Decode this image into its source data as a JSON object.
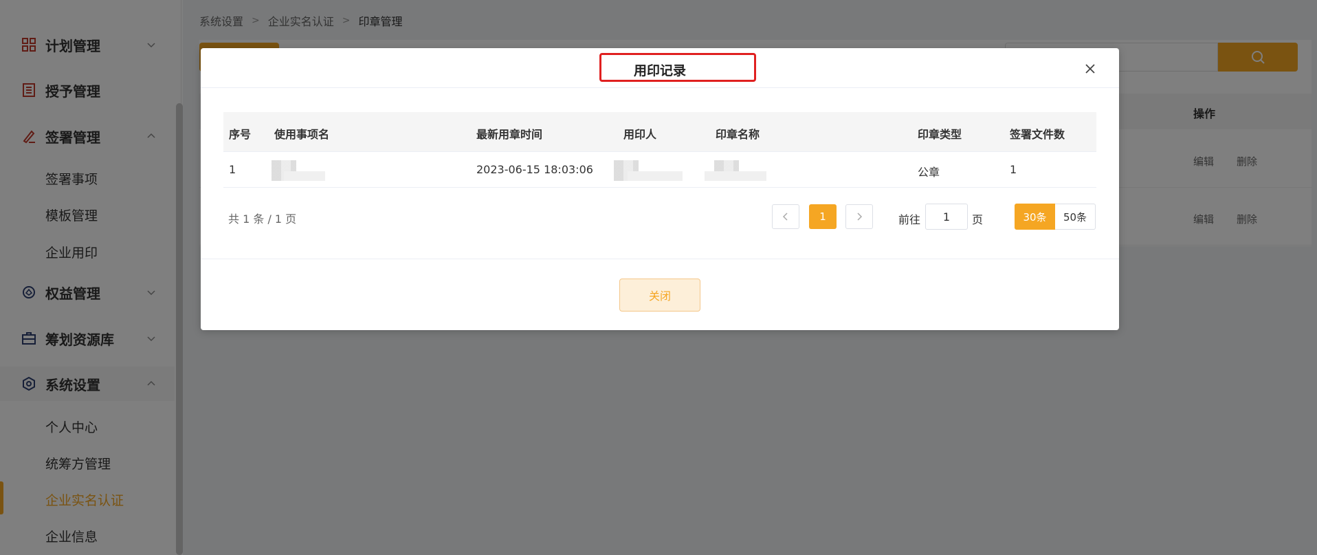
{
  "sidebar": {
    "groups": [
      {
        "label": "计划管理",
        "icon": "grid-icon"
      },
      {
        "label": "授予管理",
        "icon": "ledger-icon"
      },
      {
        "label": "签署管理",
        "icon": "pen-icon",
        "children": [
          "签署事项",
          "模板管理",
          "企业用印"
        ]
      },
      {
        "label": "权益管理",
        "icon": "badge-icon"
      },
      {
        "label": "筹划资源库",
        "icon": "briefcase-icon"
      },
      {
        "label": "系统设置",
        "icon": "settings-icon",
        "children": [
          "个人中心",
          "统筹方管理",
          "企业实名认证",
          "企业信息"
        ]
      }
    ],
    "active_item": "企业实名认证"
  },
  "breadcrumb": [
    "系统设置",
    "企业实名认证",
    "印章管理"
  ],
  "background_table": {
    "op_header": "操作",
    "rows": [
      {
        "edit": "编辑",
        "delete": "删除"
      },
      {
        "edit": "编辑",
        "delete": "删除"
      }
    ]
  },
  "dialog": {
    "title": "用印记录",
    "columns": [
      "序号",
      "使用事项名",
      "最新用章时间",
      "用印人",
      "印章名称",
      "印章类型",
      "签署文件数"
    ],
    "rows": [
      {
        "index": "1",
        "item_name": "",
        "latest_time": "2023-06-15 18:03:06",
        "user": "",
        "seal_name": "",
        "seal_type": "公章",
        "file_count": "1"
      }
    ],
    "pagination": {
      "total_text": "共 1 条 / 1 页",
      "current_page": "1",
      "goto_label": "前往",
      "goto_value": "1",
      "page_unit": "页",
      "page_sizes": [
        "30条",
        "50条"
      ],
      "selected_size": "30条"
    },
    "close_label": "关闭"
  },
  "colors": {
    "accent": "#f5a623",
    "highlight_box": "#e02020",
    "sidebar_icon": "#c0392b"
  }
}
